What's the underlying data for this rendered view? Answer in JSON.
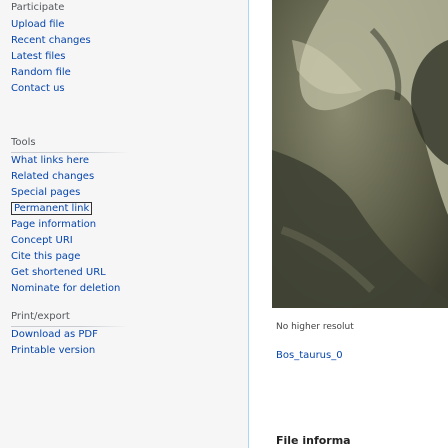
{
  "sidebar": {
    "participate": {
      "heading": "Participate",
      "items": [
        {
          "label": "Upload file"
        },
        {
          "label": "Recent changes"
        },
        {
          "label": "Latest files"
        },
        {
          "label": "Random file"
        },
        {
          "label": "Contact us"
        }
      ]
    },
    "tools": {
      "heading": "Tools",
      "items": [
        {
          "label": "What links here"
        },
        {
          "label": "Related changes"
        },
        {
          "label": "Special pages"
        },
        {
          "label": "Permanent link"
        },
        {
          "label": "Page information"
        },
        {
          "label": "Concept URI"
        },
        {
          "label": "Cite this page"
        },
        {
          "label": "Get shortened URL"
        },
        {
          "label": "Nominate for deletion"
        }
      ]
    },
    "print_export": {
      "heading": "Print/export",
      "items": [
        {
          "label": "Download as PDF"
        },
        {
          "label": "Printable version"
        }
      ]
    }
  },
  "content": {
    "resolution_note": "No higher resolut",
    "file_name": "Bos_taurus_0",
    "file_info_heading": "File informa"
  }
}
